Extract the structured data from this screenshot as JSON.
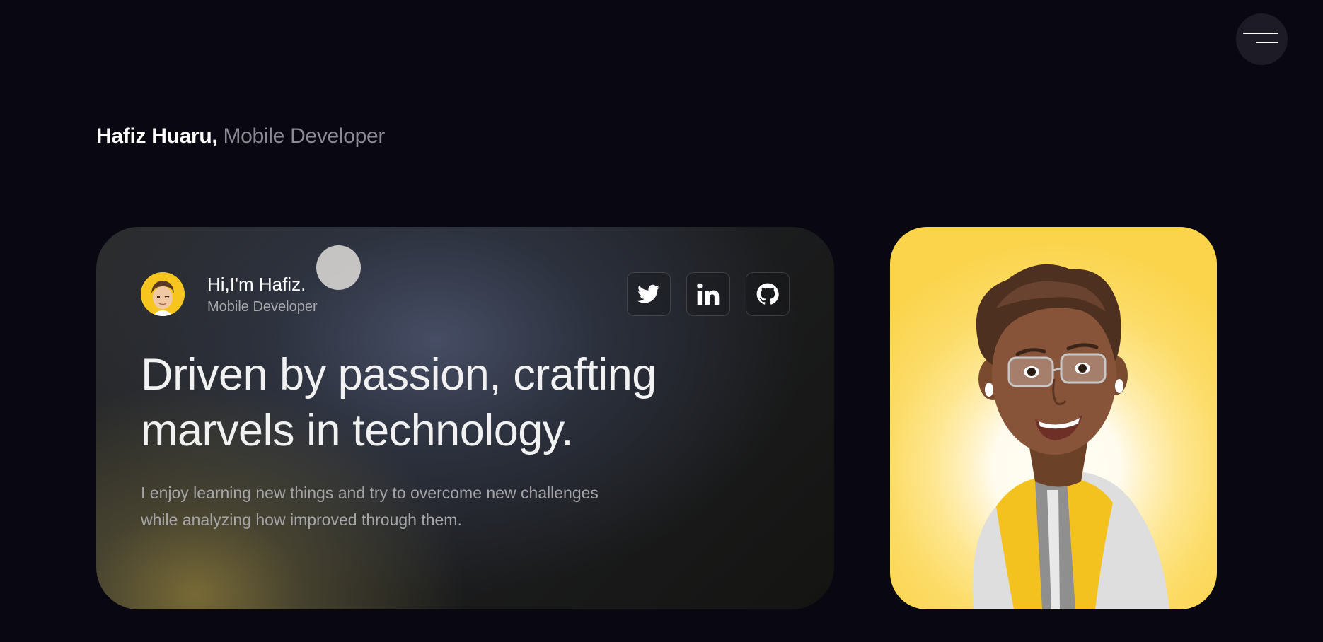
{
  "header": {
    "name": "Hafiz Huaru,",
    "role": "Mobile Developer"
  },
  "menu": {
    "icon": "hamburger-menu-icon"
  },
  "hero": {
    "greeting": "Hi,I'm Hafiz.",
    "subtitle": "Mobile Developer",
    "headline": "Driven by passion, crafting marvels in technology.",
    "description": "I enjoy learning new things and try to overcome new challenges while analyzing how improved through them.",
    "socials": [
      {
        "name": "twitter",
        "icon": "twitter-icon"
      },
      {
        "name": "linkedin",
        "icon": "linkedin-icon"
      },
      {
        "name": "github",
        "icon": "github-icon"
      }
    ]
  },
  "colors": {
    "background": "#090712",
    "accent_yellow": "#fbd44c",
    "muted_text": "#8b8a92"
  }
}
